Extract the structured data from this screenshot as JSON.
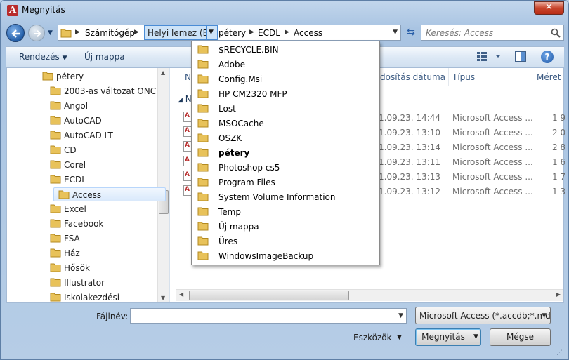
{
  "window": {
    "title": "Megnyitás",
    "app_icon_letter": "A",
    "close_symbol": "✕"
  },
  "address_bar": {
    "crumbs": [
      "Számítógép",
      "Helyi lemez (E:)",
      "pétery",
      "ECDL",
      "Access"
    ],
    "active_crumb_index": 1
  },
  "search": {
    "placeholder": "Keresés: Access"
  },
  "toolbar": {
    "organize_label": "Rendezés",
    "new_folder_label": "Új mappa",
    "help_symbol": "?"
  },
  "nav_tree": {
    "items": [
      {
        "label": "pétery",
        "level": 0
      },
      {
        "label": "2003-as változat ONC",
        "level": 1
      },
      {
        "label": "Angol",
        "level": 1
      },
      {
        "label": "AutoCAD",
        "level": 1
      },
      {
        "label": "AutoCAD LT",
        "level": 1
      },
      {
        "label": "CD",
        "level": 1
      },
      {
        "label": "Corel",
        "level": 1
      },
      {
        "label": "ECDL",
        "level": 1
      },
      {
        "label": "Access",
        "level": 2,
        "selected": true
      },
      {
        "label": "Excel",
        "level": 1
      },
      {
        "label": "Facebook",
        "level": 1
      },
      {
        "label": "FSA",
        "level": 1
      },
      {
        "label": "Ház",
        "level": 1
      },
      {
        "label": "Hősök",
        "level": 1
      },
      {
        "label": "Illustrator",
        "level": 1
      },
      {
        "label": "Iskolakezdési",
        "level": 1
      }
    ]
  },
  "file_list": {
    "columns": {
      "name": "N",
      "date": "dosítás dátuma",
      "type": "Típus",
      "size": "Méret"
    },
    "group_label": "N",
    "rows": [
      {
        "date": "1.09.23. 14:44",
        "type": "Microsoft Access ...",
        "size": "1 9"
      },
      {
        "date": "1.09.23. 13:10",
        "type": "Microsoft Access ...",
        "size": "2 0"
      },
      {
        "date": "1.09.23. 13:14",
        "type": "Microsoft Access ...",
        "size": "2 8"
      },
      {
        "date": "1.09.23. 13:11",
        "type": "Microsoft Access ...",
        "size": "1 6"
      },
      {
        "date": "1.09.23. 13:13",
        "type": "Microsoft Access ...",
        "size": "1 7"
      },
      {
        "date": "1.09.23. 13:12",
        "type": "Microsoft Access ...",
        "size": "1 3"
      }
    ]
  },
  "dropdown": {
    "items": [
      {
        "label": "$RECYCLE.BIN"
      },
      {
        "label": "Adobe"
      },
      {
        "label": "Config.Msi"
      },
      {
        "label": "HP CM2320 MFP"
      },
      {
        "label": "Lost"
      },
      {
        "label": "MSOCache"
      },
      {
        "label": "OSZK"
      },
      {
        "label": "pétery",
        "bold": true
      },
      {
        "label": "Photoshop cs5"
      },
      {
        "label": "Program Files"
      },
      {
        "label": "System Volume Information"
      },
      {
        "label": "Temp"
      },
      {
        "label": "Új mappa"
      },
      {
        "label": "Üres"
      },
      {
        "label": "WindowsImageBackup"
      }
    ]
  },
  "bottom": {
    "filename_label": "Fájlnév:",
    "filename_value": "",
    "filter_value": "Microsoft Access (*.accdb;*.mdb",
    "tools_label": "Eszközök",
    "open_label": "Megnyitás",
    "cancel_label": "Mégse"
  },
  "colors": {
    "accent": "#4a8cd6",
    "close": "#c8452c",
    "folder": "#e8c25a"
  }
}
